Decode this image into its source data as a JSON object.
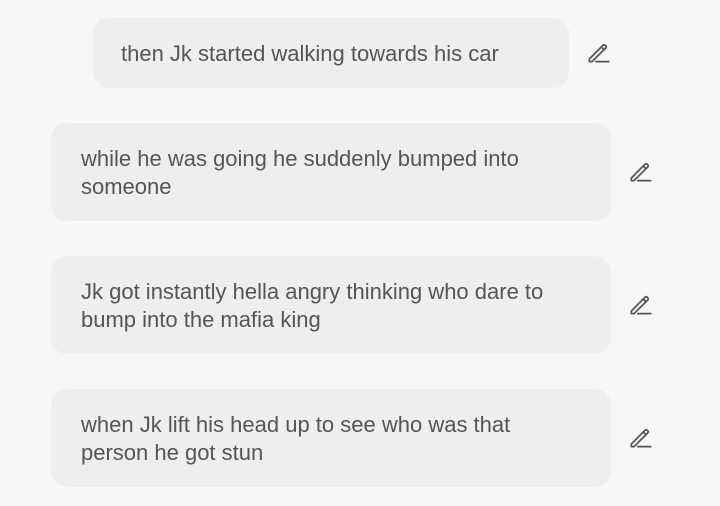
{
  "messages": [
    {
      "text": "then Jk started walking towards his car",
      "edit_icon": "pencil-icon"
    },
    {
      "text": "while he was going he suddenly bumped into someone",
      "edit_icon": "pencil-icon"
    },
    {
      "text": "Jk got instantly hella angry thinking who dare to bump into the mafia king",
      "edit_icon": "pencil-icon"
    },
    {
      "text": "when Jk lift his head up to see who was that person he got stun",
      "edit_icon": "pencil-icon"
    }
  ],
  "colors": {
    "background": "#f7f7f7",
    "bubble": "#eeeeee",
    "text": "#555555",
    "icon": "#555555"
  }
}
